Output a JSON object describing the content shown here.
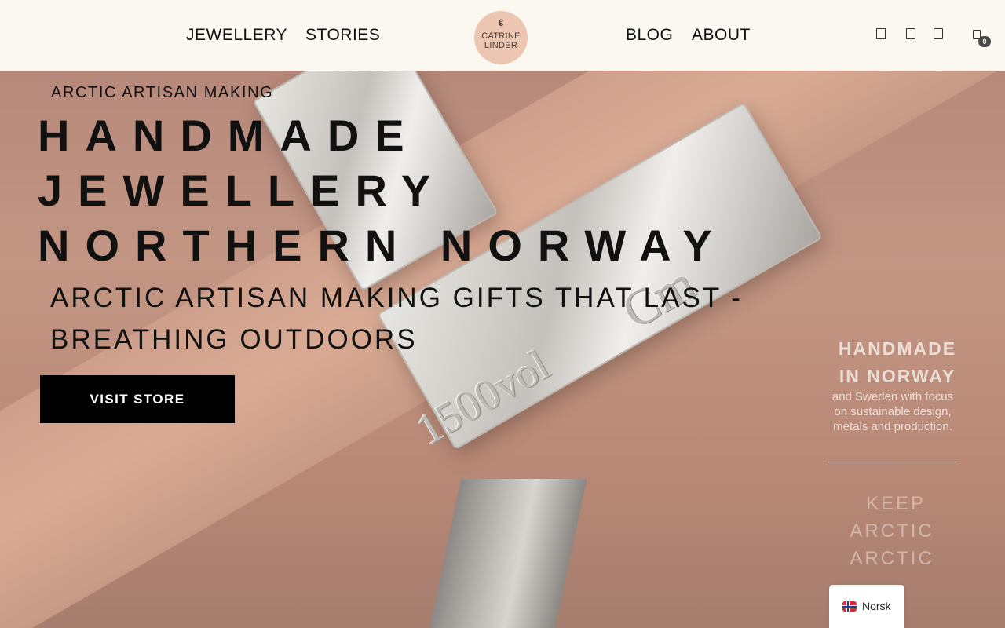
{
  "header": {
    "nav_left": [
      "JEWELLERY",
      "STORIES"
    ],
    "nav_right": [
      "BLOG",
      "ABOUT"
    ],
    "logo": {
      "mark": "€",
      "line1": "CATRINE",
      "line2": "LINDER",
      "bg_color": "#ecc6b1"
    },
    "icons": [
      "search-icon",
      "account-icon",
      "wishlist-icon",
      "cart-icon"
    ],
    "cart_count": "0"
  },
  "hero": {
    "eyebrow": "ARCTIC ARTISAN MAKING",
    "headline": [
      "HANDMADE",
      "JEWELLERY",
      "NORTHERN NORWAY"
    ],
    "subheadline": [
      "ARCTIC ARTISAN MAKING GIFTS THAT LAST -",
      "BREATHING OUTDOORS"
    ],
    "cta_label": "VISIT STORE",
    "engraving": [
      "1500vol",
      "Cm"
    ]
  },
  "side_panel": {
    "heading": [
      "HANDMADE",
      "IN NORWAY"
    ],
    "body": "and Sweden with focus on sustainable design, metals and production.",
    "keep": [
      "KEEP",
      "ARCTIC",
      "ARCTIC"
    ]
  },
  "language_switcher": {
    "label": "Norsk",
    "flag": "norway-flag-icon"
  },
  "colors": {
    "header_bg": "#fbf8f1",
    "button_bg": "#000000",
    "hero_bg": "#b58878"
  }
}
